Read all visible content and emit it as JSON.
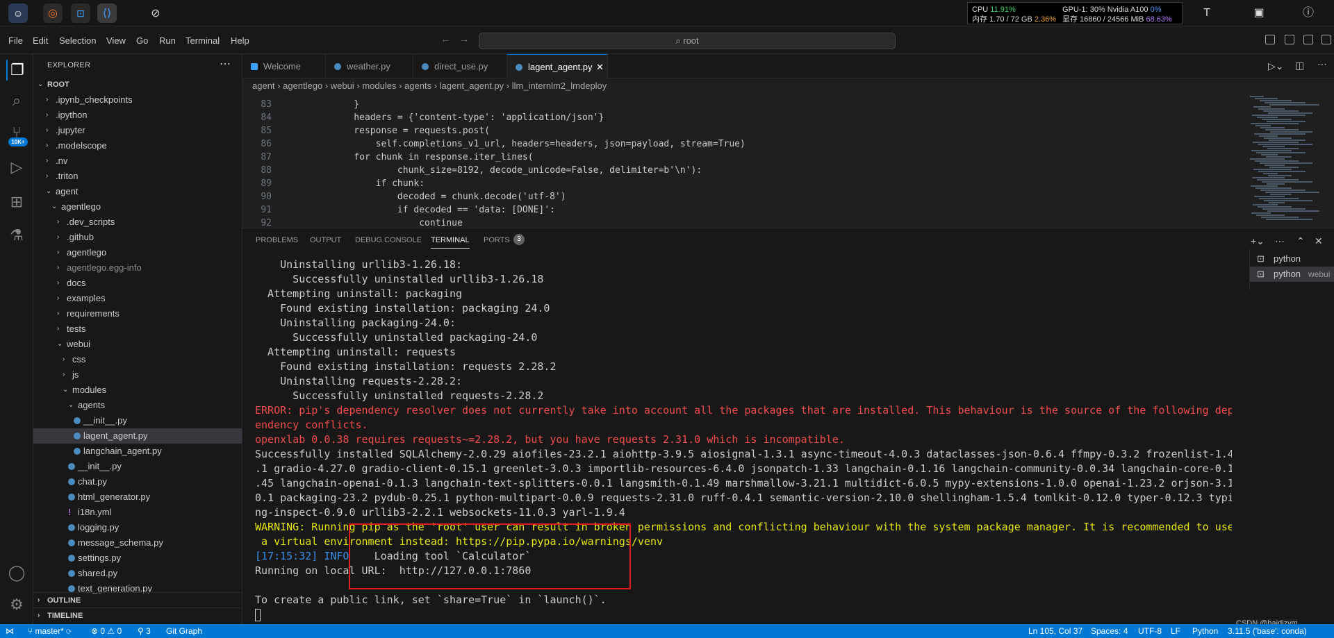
{
  "topbar": {
    "cpu_label": "CPU",
    "cpu_value": "11.91%",
    "mem_label": "内存 1.70 / 72 GB",
    "mem_value": "2.36%",
    "gpu_label": "GPU-1: 30% Nvidia A100",
    "gpu_value": "0%",
    "vram_label": "显存 16860 / 24566 MiB",
    "vram_value": "68.63%"
  },
  "menu": [
    "File",
    "Edit",
    "Selection",
    "View",
    "Go",
    "Run",
    "Terminal",
    "Help"
  ],
  "search": {
    "placeholder": "root"
  },
  "activity": {
    "badge": "10K+"
  },
  "sidebar": {
    "title": "EXPLORER",
    "root": "ROOT",
    "items": [
      {
        "label": ".ipynb_checkpoints"
      },
      {
        "label": ".ipython"
      },
      {
        "label": ".jupyter"
      },
      {
        "label": ".modelscope"
      },
      {
        "label": ".nv"
      },
      {
        "label": ".triton"
      },
      {
        "label": "agent"
      },
      {
        "label": "agentlego"
      },
      {
        "label": ".dev_scripts"
      },
      {
        "label": ".github"
      },
      {
        "label": "agentlego"
      },
      {
        "label": "agentlego.egg-info"
      },
      {
        "label": "docs"
      },
      {
        "label": "examples"
      },
      {
        "label": "requirements"
      },
      {
        "label": "tests"
      },
      {
        "label": "webui"
      },
      {
        "label": "css"
      },
      {
        "label": "js"
      },
      {
        "label": "modules"
      },
      {
        "label": "agents"
      },
      {
        "label": "__init__.py"
      },
      {
        "label": "lagent_agent.py"
      },
      {
        "label": "langchain_agent.py"
      },
      {
        "label": "__init__.py"
      },
      {
        "label": "chat.py"
      },
      {
        "label": "html_generator.py"
      },
      {
        "label": "i18n.yml"
      },
      {
        "label": "logging.py"
      },
      {
        "label": "message_schema.py"
      },
      {
        "label": "settings.py"
      },
      {
        "label": "shared.py"
      },
      {
        "label": "text_generation.py"
      }
    ],
    "outline": "OUTLINE",
    "timeline": "TIMELINE"
  },
  "tabs": [
    "Welcome",
    "weather.py",
    "direct_use.py",
    "lagent_agent.py"
  ],
  "breadcrumb": [
    "agent",
    "agentlego",
    "webui",
    "modules",
    "agents",
    "lagent_agent.py",
    "llm_internlm2_lmdeploy"
  ],
  "code": [
    {
      "n": "83",
      "t": "    }"
    },
    {
      "n": "84",
      "t": "    headers = {'content-type': 'application/json'}"
    },
    {
      "n": "85",
      "t": "    response = requests.post("
    },
    {
      "n": "86",
      "t": "        self.completions_v1_url, headers=headers, json=payload, stream=True)"
    },
    {
      "n": "87",
      "t": "    for chunk in response.iter_lines("
    },
    {
      "n": "88",
      "t": "            chunk_size=8192, decode_unicode=False, delimiter=b'\\n'):"
    },
    {
      "n": "89",
      "t": "        if chunk:"
    },
    {
      "n": "90",
      "t": "            decoded = chunk.decode('utf-8')"
    },
    {
      "n": "91",
      "t": "            if decoded == 'data: [DONE]':"
    },
    {
      "n": "92",
      "t": "                continue"
    }
  ],
  "panel_tabs": [
    "PROBLEMS",
    "OUTPUT",
    "DEBUG CONSOLE",
    "TERMINAL",
    "PORTS"
  ],
  "ports_count": "3",
  "terminal_list": [
    {
      "name": "python",
      "sub": ""
    },
    {
      "name": "python",
      "sub": "webui"
    }
  ],
  "terminal": [
    {
      "c": "",
      "t": "    Uninstalling urllib3-1.26.18:"
    },
    {
      "c": "",
      "t": "      Successfully uninstalled urllib3-1.26.18"
    },
    {
      "c": "",
      "t": "  Attempting uninstall: packaging"
    },
    {
      "c": "",
      "t": "    Found existing installation: packaging 24.0"
    },
    {
      "c": "",
      "t": "    Uninstalling packaging-24.0:"
    },
    {
      "c": "",
      "t": "      Successfully uninstalled packaging-24.0"
    },
    {
      "c": "",
      "t": "  Attempting uninstall: requests"
    },
    {
      "c": "",
      "t": "    Found existing installation: requests 2.28.2"
    },
    {
      "c": "",
      "t": "    Uninstalling requests-2.28.2:"
    },
    {
      "c": "",
      "t": "      Successfully uninstalled requests-2.28.2"
    },
    {
      "c": "err",
      "t": "ERROR: pip's dependency resolver does not currently take into account all the packages that are installed. This behaviour is the source of the following dep"
    },
    {
      "c": "err",
      "t": "endency conflicts."
    },
    {
      "c": "err",
      "t": "openxlab 0.0.38 requires requests~=2.28.2, but you have requests 2.31.0 which is incompatible."
    },
    {
      "c": "",
      "t": "Successfully installed SQLAlchemy-2.0.29 aiofiles-23.2.1 aiohttp-3.9.5 aiosignal-1.3.1 async-timeout-4.0.3 dataclasses-json-0.6.4 ffmpy-0.3.2 frozenlist-1.4"
    },
    {
      "c": "",
      "t": ".1 gradio-4.27.0 gradio-client-0.15.1 greenlet-3.0.3 importlib-resources-6.4.0 jsonpatch-1.33 langchain-0.1.16 langchain-community-0.0.34 langchain-core-0.1"
    },
    {
      "c": "",
      "t": ".45 langchain-openai-0.1.3 langchain-text-splitters-0.0.1 langsmith-0.1.49 marshmallow-3.21.1 multidict-6.0.5 mypy-extensions-1.0.0 openai-1.23.2 orjson-3.1"
    },
    {
      "c": "",
      "t": "0.1 packaging-23.2 pydub-0.25.1 python-multipart-0.0.9 requests-2.31.0 ruff-0.4.1 semantic-version-2.10.0 shellingham-1.5.4 tomlkit-0.12.0 typer-0.12.3 typi"
    },
    {
      "c": "",
      "t": "ng-inspect-0.9.0 urllib3-2.2.1 websockets-11.0.3 yarl-1.9.4"
    },
    {
      "c": "warn",
      "t": "WARNING: Running pip as the 'root' user can result in broken permissions and conflicting behaviour with the system package manager. It is recommended to use"
    },
    {
      "c": "warn",
      "t": " a virtual environment instead: https://pip.pypa.io/warnings/venv"
    },
    {
      "c": "infoline",
      "t": "    Loading tool `Calculator`",
      "ts": "[17:15:32] INFO"
    },
    {
      "c": "",
      "t": "Running on local URL:  http://127.0.0.1:7860"
    },
    {
      "c": "",
      "t": ""
    },
    {
      "c": "",
      "t": "To create a public link, set `share=True` in `launch()`."
    }
  ],
  "status": {
    "branch": "master*",
    "problems": "⊗ 0 ⚠ 0",
    "ports": "3",
    "gitgraph": "Git Graph",
    "position": "Ln 105, Col 37",
    "spaces": "Spaces: 4",
    "encoding": "UTF-8",
    "eol": "LF",
    "language": "Python",
    "interpreter": "3.11.5 ('base': conda)"
  },
  "watermark": "CSDN @haidizym",
  "colors": {
    "accent": "#0078d4",
    "error": "#f14c4c",
    "warning": "#e5e510",
    "highlight_box": "#e01e1e"
  }
}
